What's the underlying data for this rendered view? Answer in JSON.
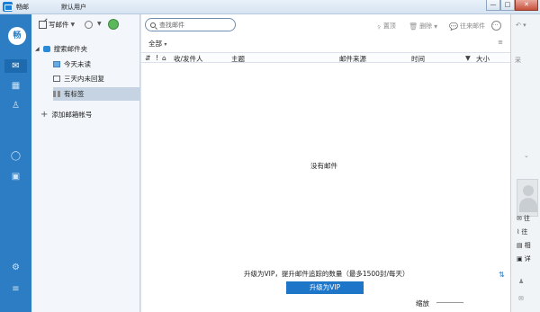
{
  "window": {
    "app_name": "畅邮",
    "user": "默认用户",
    "minimize": "—",
    "maximize": "□",
    "close": "✕"
  },
  "leftbar": {
    "avatar_text": "畅"
  },
  "folders": {
    "compose_label": "写邮件",
    "search_folder": "搜索邮件夹",
    "items": [
      "今天未读",
      "三天内未回复",
      "有标签"
    ],
    "add_account": "添加邮箱帐号"
  },
  "toolbar": {
    "search_placeholder": "查找邮件",
    "top_label": "置顶",
    "delete_label": "删除",
    "conversation_label": "往来邮件",
    "more_label": "···"
  },
  "filter": {
    "all_label": "全部",
    "menu_icon": "≡"
  },
  "columns": [
    "收/发件人",
    "主题",
    "邮件来源",
    "时间",
    "大小"
  ],
  "empty_text": "没有邮件",
  "vip": {
    "message": "升级为VIP，提升邮件追踪的数量（最多1500封/每天）",
    "button": "升级为VIP"
  },
  "zoom_label": "缩放",
  "rightpane": {
    "labels": [
      "采",
      "往",
      "往",
      "相",
      "详"
    ]
  }
}
